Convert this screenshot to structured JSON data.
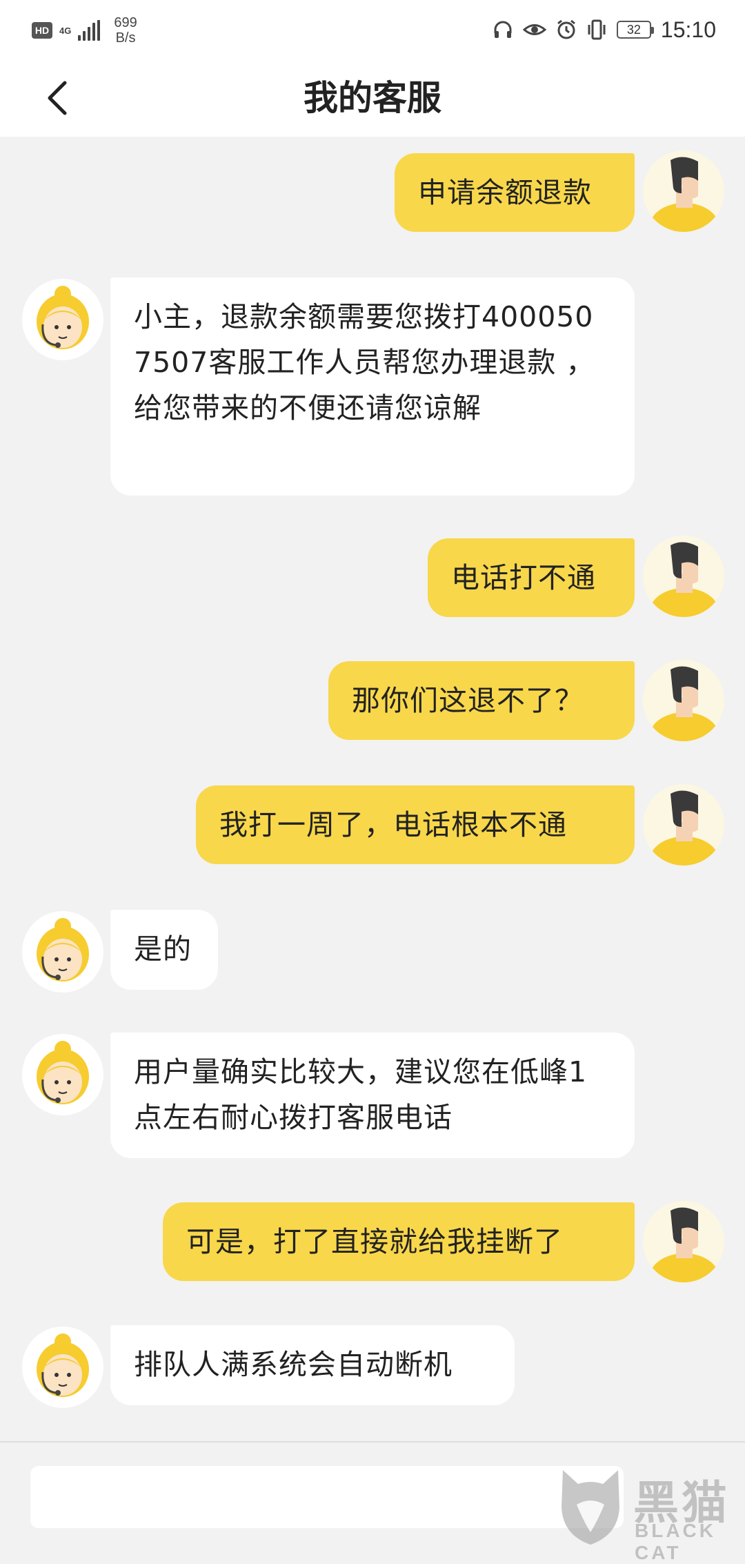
{
  "status_bar": {
    "hd": "HD",
    "network": "4G",
    "speed_value": "699",
    "speed_unit": "B/s",
    "battery": "32",
    "time": "15:10"
  },
  "header": {
    "title": "我的客服"
  },
  "messages": [
    {
      "role": "user",
      "text": "申请余额退款"
    },
    {
      "role": "agent",
      "text": "小主，退款余额需要您拨打4000507507客服工作人员帮您办理退款 ，给您带来的不便还请您谅解"
    },
    {
      "role": "user",
      "text": "电话打不通"
    },
    {
      "role": "user",
      "text": "那你们这退不了？"
    },
    {
      "role": "user",
      "text": "我打一周了，电话根本不通"
    },
    {
      "role": "agent",
      "text": "是的"
    },
    {
      "role": "agent",
      "text": "用户量确实比较大，建议您在低峰1点左右耐心拨打客服电话"
    },
    {
      "role": "user",
      "text": "可是，打了直接就给我挂断了"
    },
    {
      "role": "agent",
      "text": "排队人满系统会自动断机"
    }
  ],
  "input": {
    "value": "",
    "placeholder": ""
  },
  "watermark": {
    "cn": "黑猫",
    "en": "BLACK CAT"
  },
  "colors": {
    "user_bubble": "#f8d74a",
    "agent_bubble": "#ffffff",
    "background": "#f2f2f2"
  }
}
